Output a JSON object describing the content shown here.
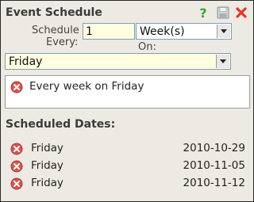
{
  "title": "Event Schedule",
  "toolbar": {
    "help_icon": "question-mark-icon",
    "save_icon": "floppy-disk-icon",
    "close_icon": "red-x-icon"
  },
  "form": {
    "schedule_every_line1": "Schedule",
    "schedule_every_line2": "Every:",
    "interval_value": "1",
    "unit_selected": "Week(s)",
    "on_label": "On:",
    "day_selected": "Friday"
  },
  "summary": {
    "text": "Every week on Friday"
  },
  "scheduled": {
    "heading": "Scheduled Dates:",
    "rows": [
      {
        "day": "Friday",
        "date": "2010-10-29"
      },
      {
        "day": "Friday",
        "date": "2010-11-05"
      },
      {
        "day": "Friday",
        "date": "2010-11-12"
      }
    ]
  },
  "colors": {
    "window_bg": "#eceae3",
    "field_bg": "#fffde0",
    "delete_red": "#d9534f"
  }
}
